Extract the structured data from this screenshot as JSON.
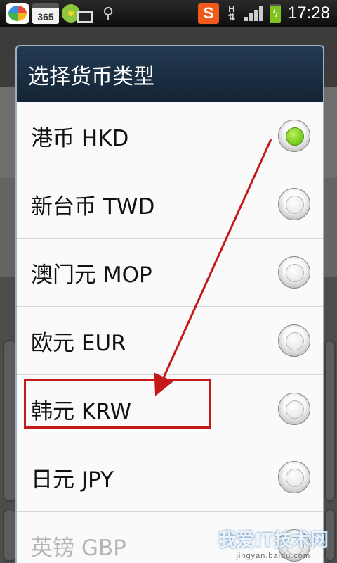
{
  "status_bar": {
    "time": "17:28",
    "notification_icons": [
      "app-market-icon",
      "calendar-365-icon",
      "sync-icon",
      "mail-icon",
      "usb-icon"
    ],
    "calendar_label": "365",
    "sogou_label": "S",
    "network_label": "H",
    "system_icons": [
      "sogou-input-icon",
      "hspa-data-icon",
      "signal-icon",
      "battery-charging-icon"
    ]
  },
  "dialog": {
    "title": "选择货币类型",
    "options": [
      {
        "label": "港币 HKD",
        "selected": true
      },
      {
        "label": "新台币 TWD",
        "selected": false
      },
      {
        "label": "澳门元 MOP",
        "selected": false
      },
      {
        "label": "欧元 EUR",
        "selected": false
      },
      {
        "label": "韩元 KRW",
        "selected": false
      },
      {
        "label": "日元 JPY",
        "selected": false
      },
      {
        "label": "英镑 GBP",
        "selected": false
      }
    ]
  },
  "annotation": {
    "color": "#c3191b",
    "highlighted_option": "韩元 KRW"
  },
  "watermark": {
    "title": "我爱IT技术网",
    "url": "jingyan.baidu.com"
  },
  "colors": {
    "accent_radio": "#5bb600",
    "title_bar": "#1c3044"
  }
}
